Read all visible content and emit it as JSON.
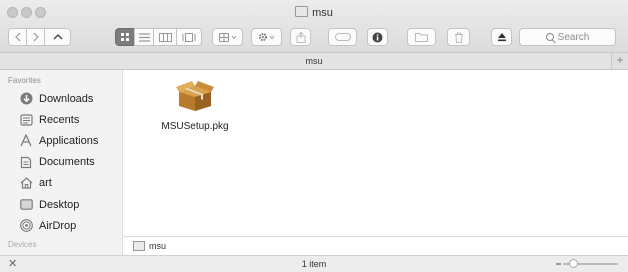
{
  "window": {
    "title": "msu"
  },
  "toolbar": {
    "search_placeholder": "Search",
    "back_icon": "chevron-left-icon",
    "forward_icon": "chevron-right-icon",
    "up_icon": "chevron-up-icon"
  },
  "tabbar": {
    "title": "msu",
    "add_icon": "plus-icon",
    "add_label": "+"
  },
  "sidebar": {
    "section": "Favorites",
    "items": [
      {
        "label": "Downloads",
        "icon": "downloads-icon"
      },
      {
        "label": "Recents",
        "icon": "recents-icon"
      },
      {
        "label": "Applications",
        "icon": "applications-icon"
      },
      {
        "label": "Documents",
        "icon": "documents-icon"
      },
      {
        "label": "art",
        "icon": "home-icon"
      },
      {
        "label": "Desktop",
        "icon": "desktop-icon"
      },
      {
        "label": "AirDrop",
        "icon": "airdrop-icon"
      }
    ],
    "devices_section": "Devices"
  },
  "main": {
    "files": [
      {
        "name": "MSUSetup.pkg",
        "icon": "package-icon"
      }
    ]
  },
  "pathbar": {
    "folder": "msu"
  },
  "statusbar": {
    "text": "1 item",
    "close_label": "✕"
  }
}
